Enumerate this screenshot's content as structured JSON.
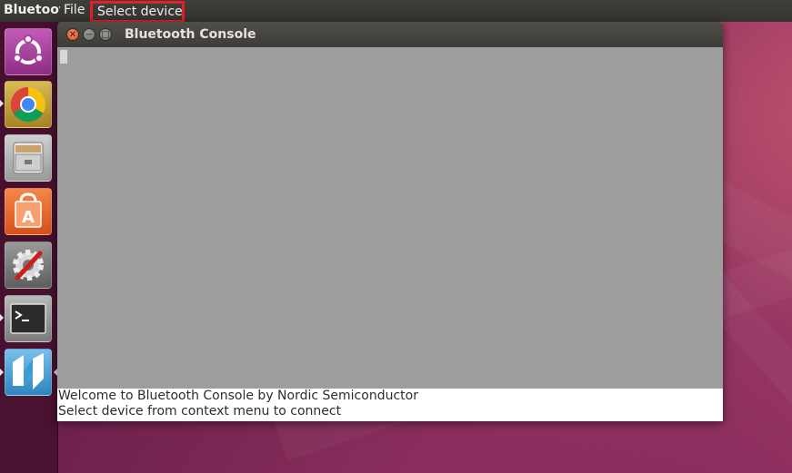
{
  "topbar": {
    "app_title": "Bluetooth Console",
    "menu": {
      "file_label": "File",
      "select_device_label": "Select device"
    }
  },
  "launcher": {
    "items": [
      {
        "name": "ubuntu-dash",
        "icon": "ubuntu-logo-icon",
        "color": "#b04fa8"
      },
      {
        "name": "chrome",
        "icon": "chrome-icon",
        "color": "#c4a33b"
      },
      {
        "name": "files",
        "icon": "file-cabinet-icon",
        "color": "#bdbdbd"
      },
      {
        "name": "software-center",
        "icon": "shopping-bag-icon",
        "color": "#f06a2c"
      },
      {
        "name": "system-settings",
        "icon": "gear-wrench-icon",
        "color": "#8a8a8a"
      },
      {
        "name": "terminal",
        "icon": "terminal-icon",
        "color": "#8e8e8e"
      },
      {
        "name": "nrf-connect",
        "icon": "nordic-logo-icon",
        "color": "#5aa8d8"
      }
    ]
  },
  "window": {
    "title": "Bluetooth Console",
    "log_lines": [
      "Welcome to Bluetooth Console by Nordic Semiconductor",
      "Select device from context menu to connect"
    ]
  },
  "colors": {
    "highlight": "#e0212a",
    "console_bg": "#9d9d9d",
    "desktop": "#7a2653"
  }
}
